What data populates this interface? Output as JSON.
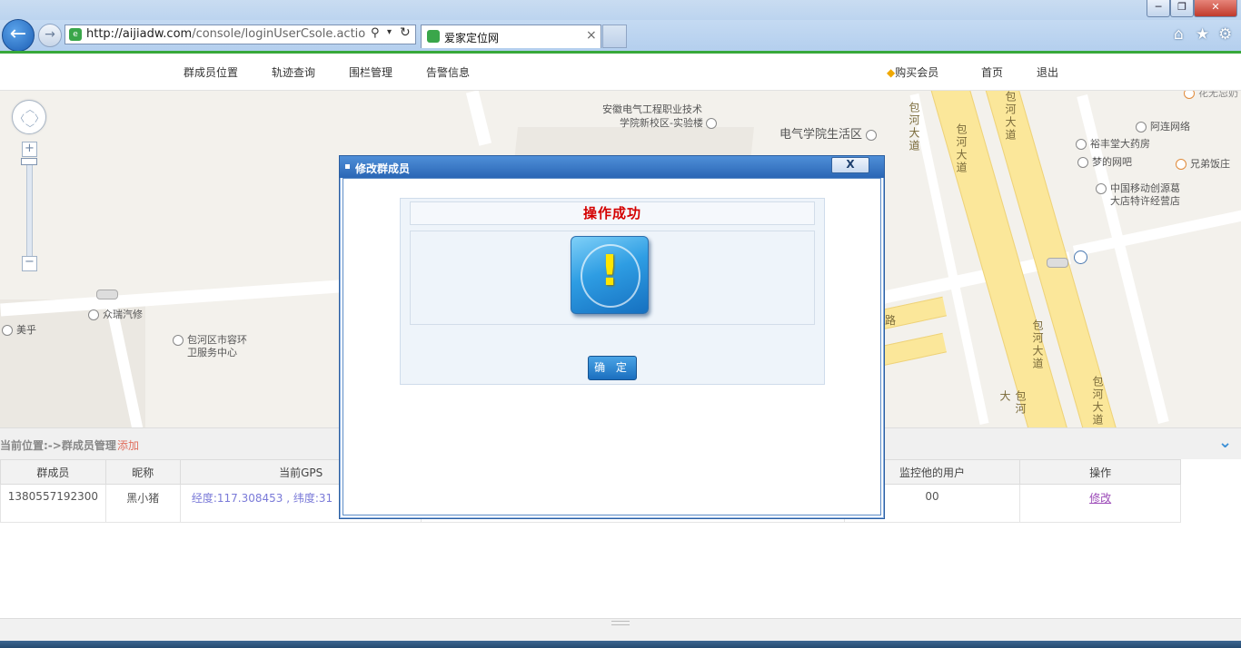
{
  "browser": {
    "url_main": "http://aijiadw.com",
    "url_rest": "/console/loginUserCsole.action;jses",
    "tab_title": "爱家定位网",
    "win_min": "─",
    "win_max": "❐",
    "win_close": "✕"
  },
  "nav": {
    "items": [
      "群成员位置",
      "轨迹查询",
      "围栏管理",
      "告警信息"
    ],
    "vip": "购买会员",
    "home": "首页",
    "logout": "退出"
  },
  "map": {
    "labels": {
      "anhui_college": "安徽电气工程职业技术",
      "anhui_college_2": "学院新校区-实验楼",
      "dianqi_life": "电气学院生活区",
      "baohe_road_1": "包河大道",
      "baohe_road_2": "包河大道",
      "baohe_road_3": "包河大道",
      "baohe_road_4": "包河大道",
      "baohe_road_5": "包河大道",
      "aliannet": "阿连网络",
      "yufengtang": "裕丰堂大药房",
      "mengnet": "梦的网吧",
      "xiongdi": "兄弟饭庄",
      "cmcc_1": "中国移动创源葛",
      "cmcc_2": "大店特许经营店",
      "zhongrui": "众瑞汽修",
      "meihu": "美乎",
      "baohe_city_1": "包河区市容环",
      "baohe_city_2": "卫服务中心",
      "lu": "路",
      "top_right": "花无忌奶"
    }
  },
  "management": {
    "breadcrumb": "当前位置:->群成员管理",
    "add": "添加",
    "table": {
      "headers": [
        "群成员",
        "昵称",
        "当前GPS",
        "",
        "监控他的用户",
        "操作"
      ],
      "rows": [
        {
          "member": "1380557192300",
          "nickname": "黑小猪",
          "gps": "经度:117.308453 , 纬度:31",
          "watchers": "00",
          "action": "修改"
        }
      ]
    }
  },
  "modal": {
    "title": "修改群成员",
    "close": "X",
    "message": "操作成功",
    "confirm": "确 定"
  }
}
